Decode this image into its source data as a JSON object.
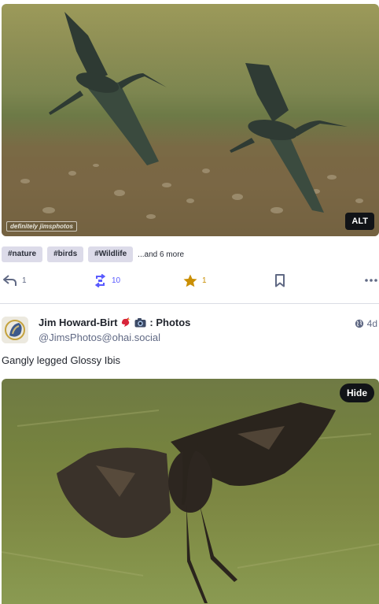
{
  "post1": {
    "watermark_text": "definitely jimsphotos",
    "alt_label": "ALT",
    "tags": [
      "#nature",
      "#birds",
      "#Wildlife"
    ],
    "more_tags": "...and 6 more",
    "actions": {
      "reply_count": "1",
      "boost_count": "10",
      "favourite_count": "1"
    },
    "colors": {
      "boost": "#595aff",
      "favourite": "#ca8f04",
      "icon": "#606984"
    }
  },
  "post2": {
    "author_name": "Jim Howard-Birt",
    "author_suffix": ": Photos",
    "author_emoji": [
      "red-bird-icon",
      "camera-icon"
    ],
    "handle": "@JimsPhotos@ohai.social",
    "visibility_icon": "globe-icon",
    "timestamp": "4d",
    "text": "Gangly legged Glossy Ibis",
    "hide_label": "Hide"
  }
}
